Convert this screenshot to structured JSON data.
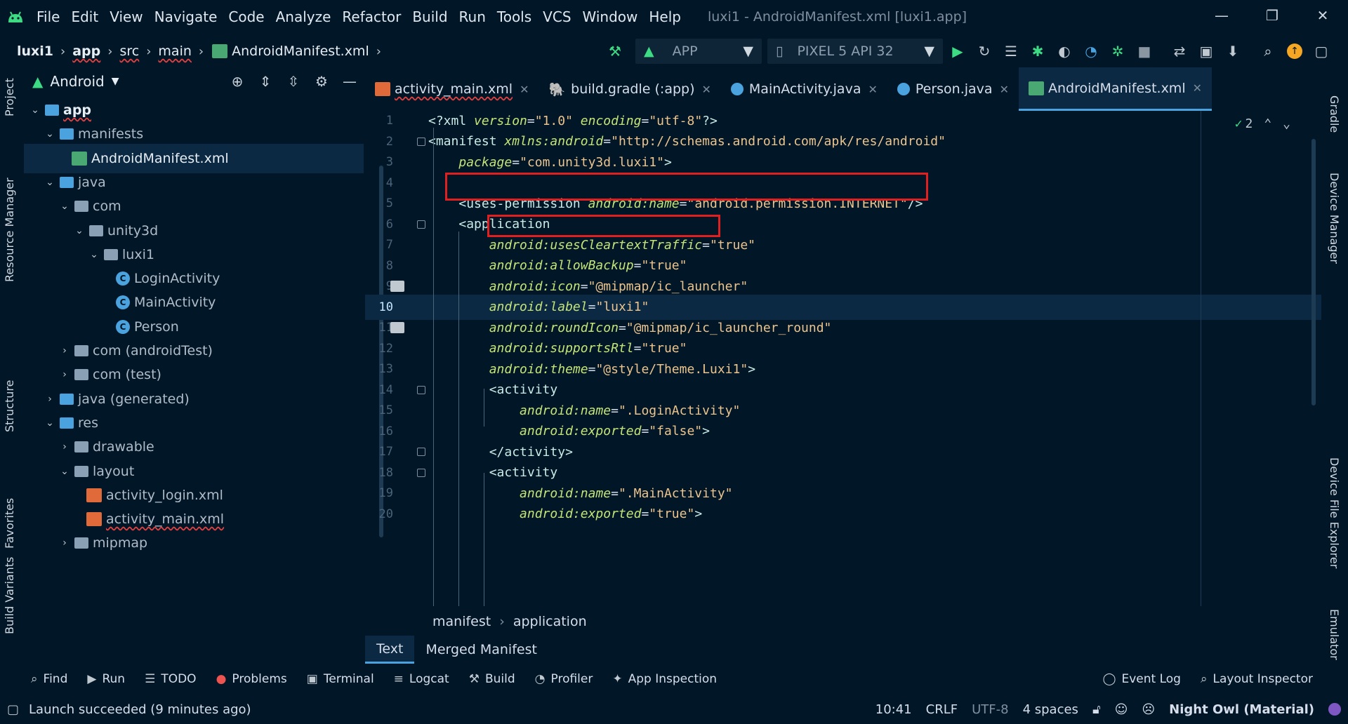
{
  "menu": {
    "items": [
      "File",
      "Edit",
      "View",
      "Navigate",
      "Code",
      "Analyze",
      "Refactor",
      "Build",
      "Run",
      "Tools",
      "VCS",
      "Window",
      "Help"
    ],
    "title": "luxi1 - AndroidManifest.xml [luxi1.app]"
  },
  "nav": {
    "crumbs": [
      "luxi1",
      "app",
      "src",
      "main",
      "AndroidManifest.xml"
    ],
    "run_config": "APP",
    "device": "PIXEL 5 API 32"
  },
  "project": {
    "view": "Android",
    "tree": [
      {
        "label": "app",
        "depth": 0,
        "kind": "module"
      },
      {
        "label": "manifests",
        "depth": 1,
        "kind": "folder-blue"
      },
      {
        "label": "AndroidManifest.xml",
        "depth": 2,
        "kind": "manifest",
        "selected": true
      },
      {
        "label": "java",
        "depth": 1,
        "kind": "folder-blue"
      },
      {
        "label": "com",
        "depth": 2,
        "kind": "folder"
      },
      {
        "label": "unity3d",
        "depth": 3,
        "kind": "folder"
      },
      {
        "label": "luxi1",
        "depth": 4,
        "kind": "folder"
      },
      {
        "label": "LoginActivity",
        "depth": 5,
        "kind": "class"
      },
      {
        "label": "MainActivity",
        "depth": 5,
        "kind": "class"
      },
      {
        "label": "Person",
        "depth": 5,
        "kind": "class"
      },
      {
        "label": "com (androidTest)",
        "depth": 2,
        "kind": "folder"
      },
      {
        "label": "com (test)",
        "depth": 2,
        "kind": "folder"
      },
      {
        "label": "java (generated)",
        "depth": 1,
        "kind": "folder-gen"
      },
      {
        "label": "res",
        "depth": 1,
        "kind": "folder-blue"
      },
      {
        "label": "drawable",
        "depth": 2,
        "kind": "folder"
      },
      {
        "label": "layout",
        "depth": 2,
        "kind": "folder"
      },
      {
        "label": "activity_login.xml",
        "depth": 3,
        "kind": "xml"
      },
      {
        "label": "activity_main.xml",
        "depth": 3,
        "kind": "xml"
      },
      {
        "label": "mipmap",
        "depth": 2,
        "kind": "folder"
      }
    ]
  },
  "side_tools": {
    "left": [
      "Project",
      "Resource Manager",
      "Structure",
      "Favorites",
      "Build Variants"
    ],
    "right": [
      "Gradle",
      "Device Manager",
      "Device File Explorer",
      "Emulator"
    ]
  },
  "tabs": [
    {
      "label": "activity_main.xml",
      "active": false
    },
    {
      "label": "build.gradle (:app)",
      "active": false
    },
    {
      "label": "MainActivity.java",
      "active": false
    },
    {
      "label": "Person.java",
      "active": false
    },
    {
      "label": "AndroidManifest.xml",
      "active": true
    }
  ],
  "editor": {
    "inspection_count": "2",
    "current_line": "10",
    "lines": [
      {
        "n": "1",
        "text": "<?xml version=\"1.0\" encoding=\"utf-8\"?>"
      },
      {
        "n": "2",
        "text": "<manifest xmlns:android=\"http://schemas.android.com/apk/res/android\""
      },
      {
        "n": "3",
        "text": "    package=\"com.unity3d.luxi1\">"
      },
      {
        "n": "4",
        "text": ""
      },
      {
        "n": "5",
        "text": "    <uses-permission android:name=\"android.permission.INTERNET\"/>"
      },
      {
        "n": "6",
        "text": "    <application"
      },
      {
        "n": "7",
        "text": "        android:usesCleartextTraffic=\"true\""
      },
      {
        "n": "8",
        "text": "        android:allowBackup=\"true\""
      },
      {
        "n": "9",
        "text": "        android:icon=\"@mipmap/ic_launcher\""
      },
      {
        "n": "10",
        "text": "        android:label=\"luxi1\""
      },
      {
        "n": "11",
        "text": "        android:roundIcon=\"@mipmap/ic_launcher_round\""
      },
      {
        "n": "12",
        "text": "        android:supportsRtl=\"true\""
      },
      {
        "n": "13",
        "text": "        android:theme=\"@style/Theme.Luxi1\">"
      },
      {
        "n": "14",
        "text": "        <activity"
      },
      {
        "n": "15",
        "text": "            android:name=\".LoginActivity\""
      },
      {
        "n": "16",
        "text": "            android:exported=\"false\">"
      },
      {
        "n": "17",
        "text": "        </activity>"
      },
      {
        "n": "18",
        "text": "        <activity"
      },
      {
        "n": "19",
        "text": "            android:name=\".MainActivity\""
      },
      {
        "n": "20",
        "text": "            android:exported=\"true\">"
      }
    ],
    "breadcrumb": [
      "manifest",
      "application"
    ],
    "modes": [
      "Text",
      "Merged Manifest"
    ]
  },
  "bottom_tools": [
    "Find",
    "Run",
    "TODO",
    "Problems",
    "Terminal",
    "Logcat",
    "Build",
    "Profiler",
    "App Inspection"
  ],
  "bottom_right_tools": [
    "Event Log",
    "Layout Inspector"
  ],
  "status": {
    "message": "Launch succeeded (9 minutes ago)",
    "position": "10:41",
    "line_sep": "CRLF",
    "encoding": "UTF-8",
    "indent": "4 spaces",
    "theme": "Night Owl (Material)"
  },
  "colors": {
    "background": "#011627",
    "tag": "#caece6",
    "attribute": "#c5e478",
    "value": "#ecc48d",
    "highlight_box": "#e02020",
    "accent": "#4aa3df"
  }
}
